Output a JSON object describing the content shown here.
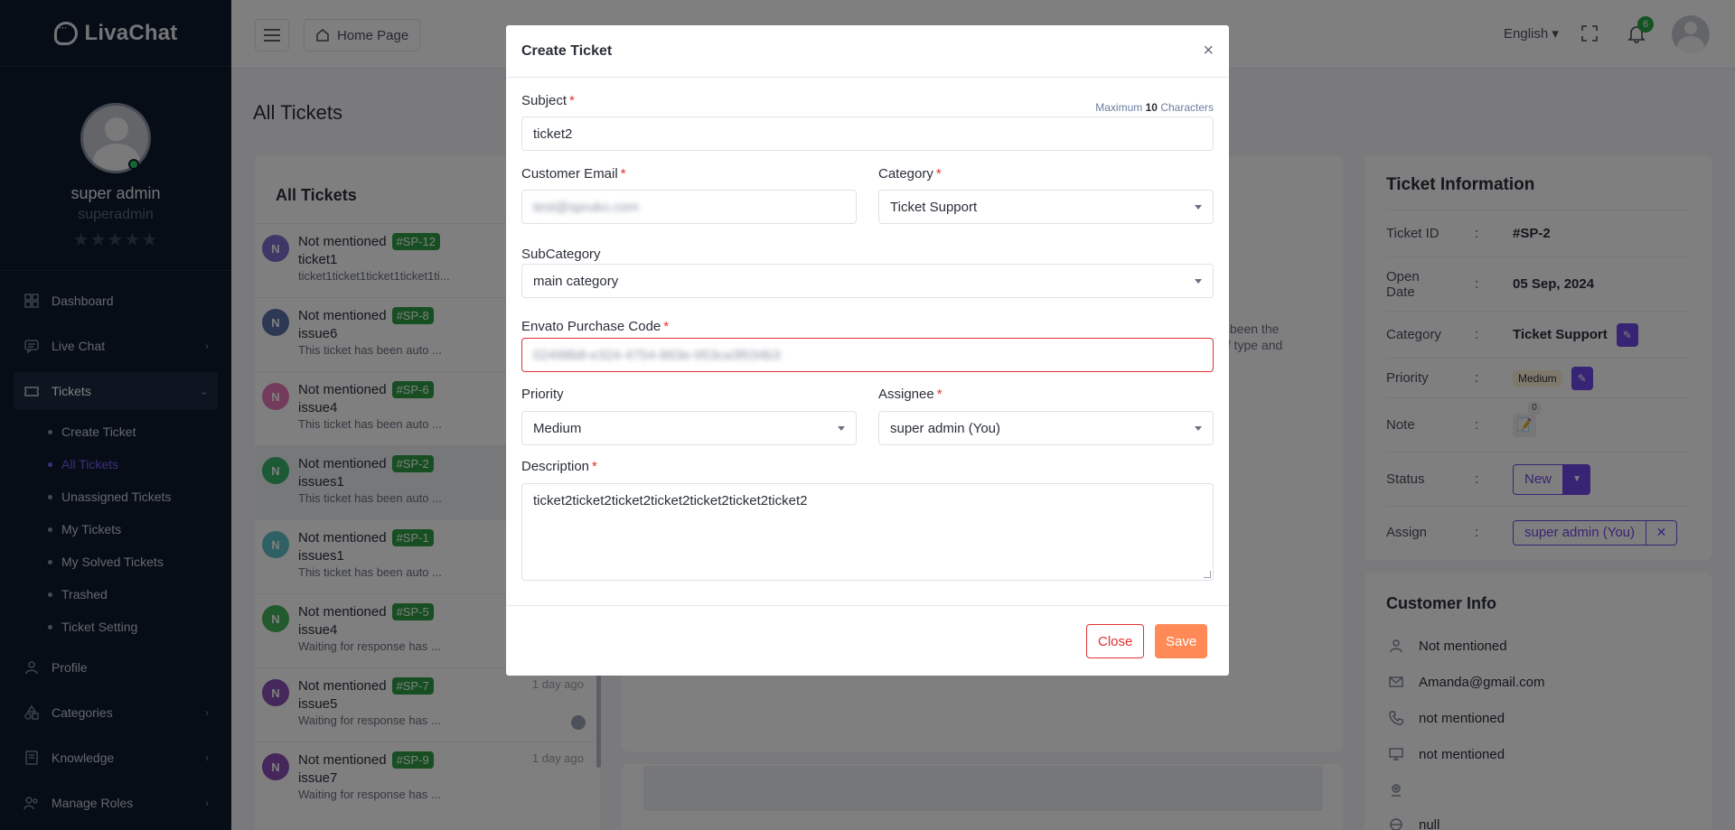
{
  "brand": {
    "name": "LivaChat"
  },
  "profile": {
    "name": "super admin",
    "username": "superadmin",
    "stars": "★★★★★"
  },
  "nav": {
    "dashboard": "Dashboard",
    "live_chat": "Live Chat",
    "tickets": "Tickets",
    "tickets_sub": [
      "Create Ticket",
      "All Tickets",
      "Unassigned Tickets",
      "My Tickets",
      "My Solved Tickets",
      "Trashed",
      "Ticket Setting"
    ],
    "profile": "Profile",
    "categories": "Categories",
    "knowledge": "Knowledge",
    "manage_roles": "Manage Roles"
  },
  "topbar": {
    "home": "Home Page",
    "language": "English",
    "notifications": "6"
  },
  "page": {
    "title": "All Tickets"
  },
  "tickets_list": {
    "heading": "All Tickets",
    "items": [
      {
        "initial": "N",
        "name": "Not mentioned",
        "id": "#SP-12",
        "subject": "ticket1",
        "snippet": "ticket1ticket1ticket1ticket1ti...",
        "time": "",
        "color": "#7c6fd1"
      },
      {
        "initial": "N",
        "name": "Not mentioned",
        "id": "#SP-8",
        "subject": "issue6",
        "snippet": "This ticket has been auto ...",
        "time": "",
        "color": "#5a73a8"
      },
      {
        "initial": "N",
        "name": "Not mentioned",
        "id": "#SP-6",
        "subject": "issue4",
        "snippet": "This ticket has been auto ...",
        "time": "",
        "color": "#e879b9"
      },
      {
        "initial": "N",
        "name": "Not mentioned",
        "id": "#SP-2",
        "subject": "issues1",
        "snippet": "This ticket has been auto ...",
        "time": "",
        "color": "#38b26a"
      },
      {
        "initial": "N",
        "name": "Not mentioned",
        "id": "#SP-1",
        "subject": "issues1",
        "snippet": "This ticket has been auto ...",
        "time": "",
        "color": "#5cc1c9"
      },
      {
        "initial": "N",
        "name": "Not mentioned",
        "id": "#SP-5",
        "subject": "issue4",
        "snippet": "Waiting for response has ...",
        "time": "",
        "color": "#44b25a"
      },
      {
        "initial": "N",
        "name": "Not mentioned",
        "id": "#SP-7",
        "subject": "issue5",
        "snippet": "Waiting for response has ...",
        "time": "1 day ago",
        "color": "#8a4fb8"
      },
      {
        "initial": "N",
        "name": "Not mentioned",
        "id": "#SP-9",
        "subject": "issue7",
        "snippet": "Waiting for response has ...",
        "time": "1 day ago",
        "color": "#8a4fb8"
      }
    ]
  },
  "background_text": {
    "line1": "s been the",
    "line2": "of type and"
  },
  "ticket_info": {
    "title": "Ticket Information",
    "id_label": "Ticket ID",
    "id_value": "#SP-2",
    "open_label_1": "Open",
    "open_label_2": "Date",
    "open_value": "05 Sep, 2024",
    "category_label": "Category",
    "category_value": "Ticket Support",
    "priority_label": "Priority",
    "priority_value": "Medium",
    "note_label": "Note",
    "note_count": "0",
    "status_label": "Status",
    "status_value": "New",
    "assign_label": "Assign",
    "assign_value": "super admin (You)",
    "colon": ":"
  },
  "customer_info": {
    "title": "Customer Info",
    "name": "Not mentioned",
    "email": "Amanda@gmail.com",
    "phone": "not mentioned",
    "device": "not mentioned",
    "location": "",
    "other": "null"
  },
  "modal": {
    "title": "Create Ticket",
    "close_symbol": "×",
    "subject_label": "Subject",
    "max_prefix": "Maximum",
    "max_count": "10",
    "max_suffix": "Characters",
    "subject_value": "ticket2",
    "email_label": "Customer Email",
    "email_value": "test@spruko.com",
    "category_label": "Category",
    "category_value": "Ticket Support",
    "subcategory_label": "SubCategory",
    "subcategory_value": "main category",
    "envato_label": "Envato Purchase Code",
    "envato_value": "02498b8-e324-4754-863e-953ca3f034b3",
    "priority_label": "Priority",
    "priority_value": "Medium",
    "assignee_label": "Assignee",
    "assignee_value": "super admin (You)",
    "description_label": "Description",
    "description_value": "ticket2ticket2ticket2ticket2ticket2ticket2ticket2",
    "required_mark": "*",
    "close_button": "Close",
    "save_button": "Save"
  },
  "colors": {
    "accent": "#7048e8",
    "save": "#ff8a57",
    "danger": "#e03131",
    "sidebar": "#0d1b2e"
  }
}
